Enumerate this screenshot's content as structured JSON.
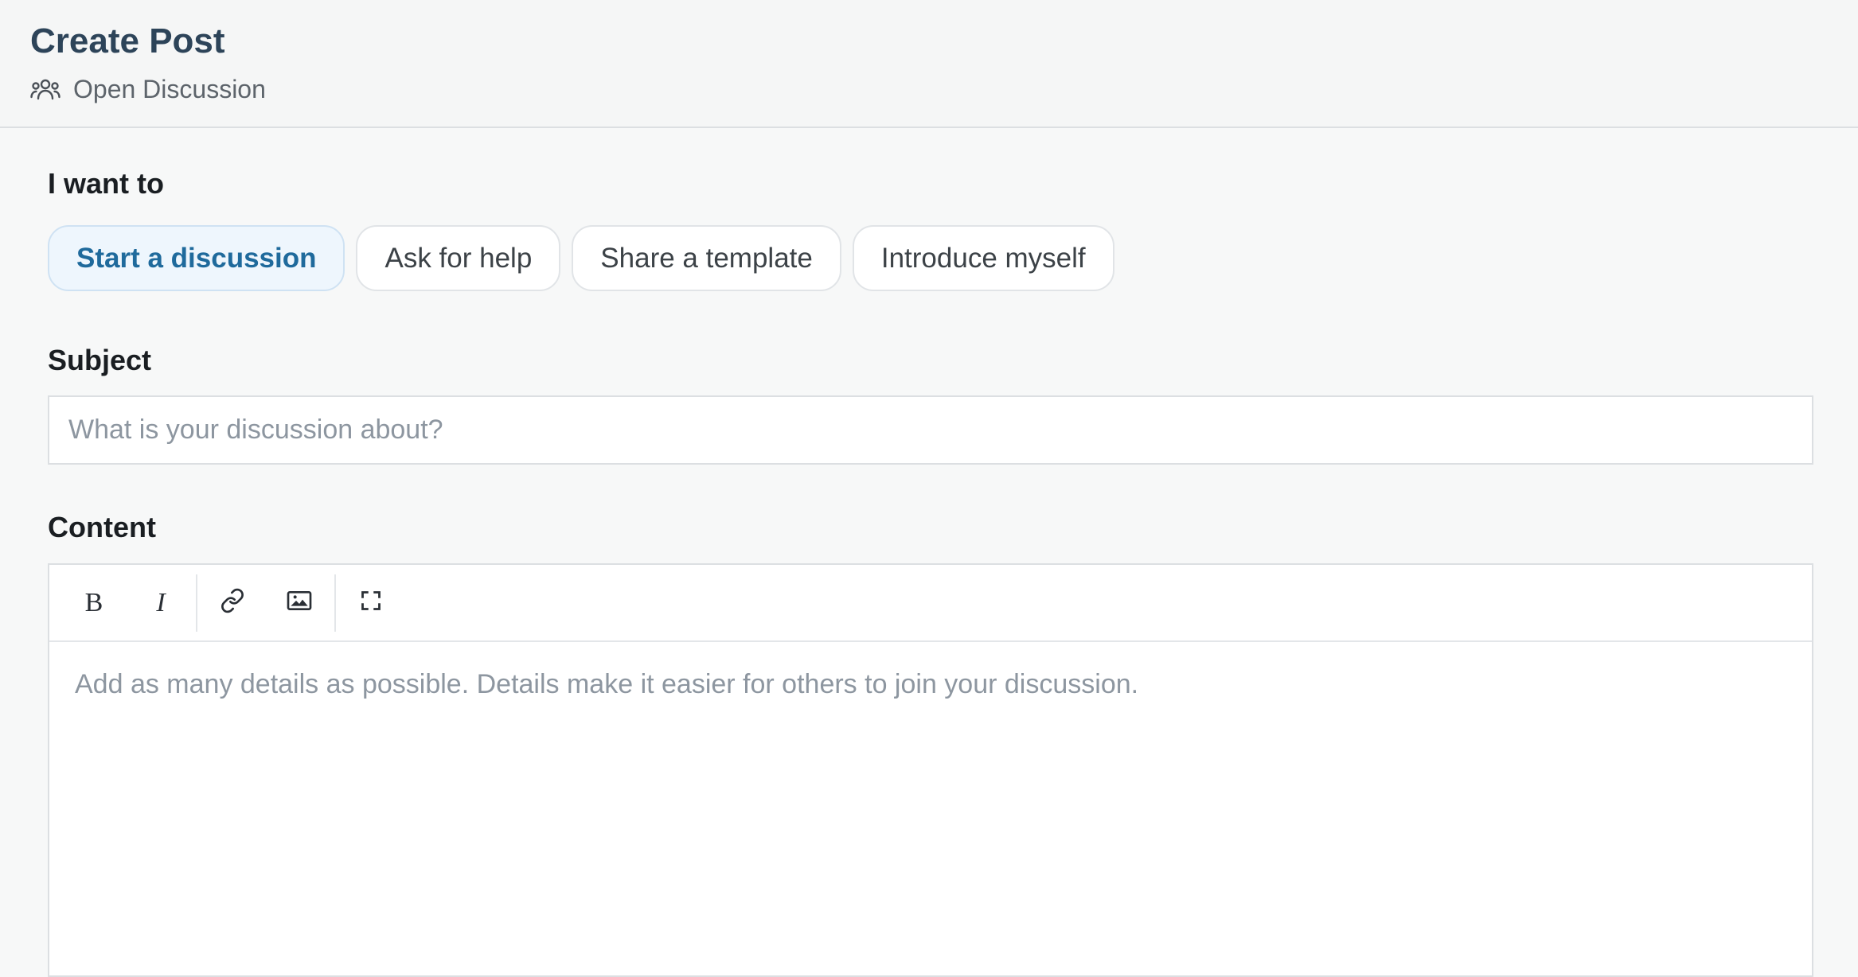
{
  "header": {
    "title": "Create Post",
    "community": "Open Discussion",
    "community_icon": "users-icon"
  },
  "intent": {
    "label": "I want to",
    "options": [
      {
        "label": "Start a discussion",
        "selected": true
      },
      {
        "label": "Ask for help",
        "selected": false
      },
      {
        "label": "Share a template",
        "selected": false
      },
      {
        "label": "Introduce myself",
        "selected": false
      }
    ]
  },
  "subject": {
    "label": "Subject",
    "value": "",
    "placeholder": "What is your discussion about?"
  },
  "content": {
    "label": "Content",
    "value": "",
    "placeholder": "Add as many details as possible. Details make it easier for others to join your discussion.",
    "toolbar": {
      "bold_glyph": "B",
      "italic_glyph": "I",
      "icons": [
        "bold-icon",
        "italic-icon",
        "link-icon",
        "image-icon",
        "fullscreen-icon"
      ]
    }
  },
  "colors": {
    "title": "#2d4459",
    "selected_pill_bg": "#eef6fd",
    "selected_pill_text": "#1f6a9c",
    "placeholder": "#8d96a0"
  }
}
